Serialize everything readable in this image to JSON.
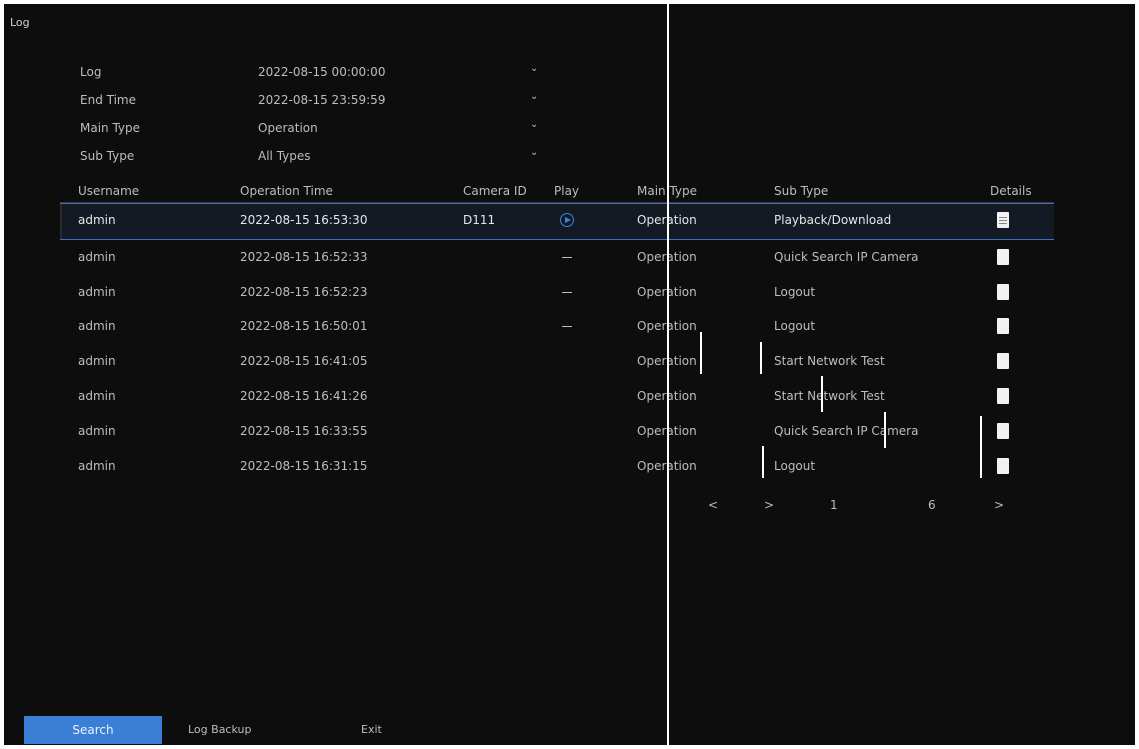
{
  "window": {
    "title": "Log"
  },
  "filters": [
    {
      "label": "Log",
      "value": "2022-08-15 00:00:00"
    },
    {
      "label": "End Time",
      "value": "2022-08-15 23:59:59"
    },
    {
      "label": "Main Type",
      "value": "Operation"
    },
    {
      "label": "Sub Type",
      "value": "All Types"
    }
  ],
  "table": {
    "headers": {
      "username": "Username",
      "operation_time": "Operation Time",
      "camera_id": "Camera ID",
      "play": "Play",
      "main_type": "Main Type",
      "sub_type": "Sub Type",
      "details": "Details"
    },
    "rows": [
      {
        "username": "admin",
        "time": "2022-08-15 16:53:30",
        "camera": "D111",
        "play": "play",
        "main": "Operation",
        "sub": "Playback/Download"
      },
      {
        "username": "admin",
        "time": "2022-08-15 16:52:33",
        "camera": "",
        "play": "—",
        "main": "Operation",
        "sub": "Quick Search IP Camera"
      },
      {
        "username": "admin",
        "time": "2022-08-15 16:52:23",
        "camera": "",
        "play": "—",
        "main": "Operation",
        "sub": "Logout"
      },
      {
        "username": "admin",
        "time": "2022-08-15 16:50:01",
        "camera": "",
        "play": "—",
        "main": "Operation",
        "sub": "Logout"
      },
      {
        "username": "admin",
        "time": "2022-08-15 16:41:05",
        "camera": "",
        "play": "",
        "main": "Operation",
        "sub": "Start Network Test"
      },
      {
        "username": "admin",
        "time": "2022-08-15 16:41:26",
        "camera": "",
        "play": "",
        "main": "Operation",
        "sub": "Start Network Test"
      },
      {
        "username": "admin",
        "time": "2022-08-15 16:33:55",
        "camera": "",
        "play": "",
        "main": "Operation",
        "sub": "Quick Search IP Camera"
      },
      {
        "username": "admin",
        "time": "2022-08-15 16:31:15",
        "camera": "",
        "play": "",
        "main": "Operation",
        "sub": "Logout"
      }
    ]
  },
  "pagination": {
    "first": "<",
    "prev": ">",
    "current": "1",
    "total": "6",
    "next": ">"
  },
  "actions": {
    "search": "Search",
    "backup": "Log Backup",
    "exit": "Exit"
  },
  "colors": {
    "accent": "#3a7fd5",
    "background": "#0d0d0d",
    "text": "#bdbdbd"
  }
}
